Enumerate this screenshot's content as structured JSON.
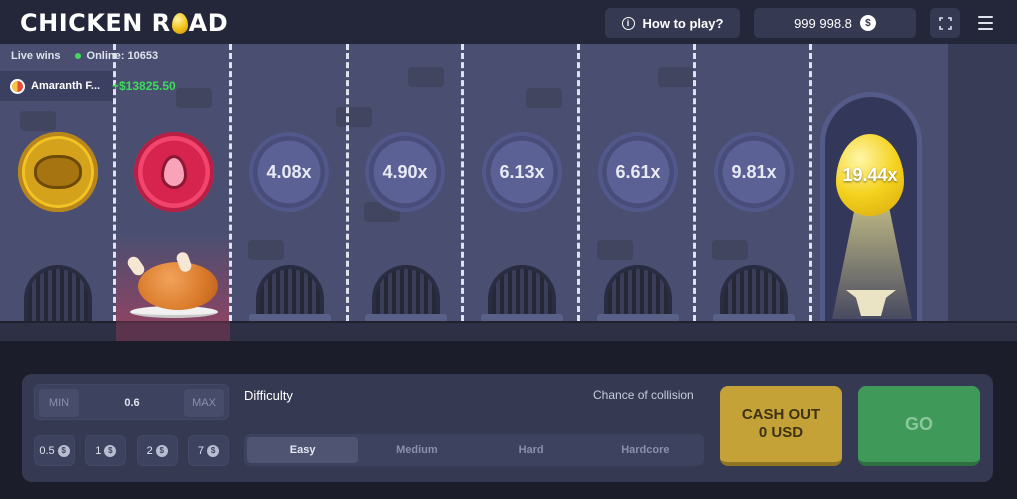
{
  "header": {
    "logo_left": "CHICKEN R",
    "logo_right": "AD",
    "how_to_play": "How to play?",
    "balance": "999 998.8",
    "currency_symbol": "$"
  },
  "live": {
    "label": "Live wins",
    "online": "Online: 10653",
    "winner_name": "Amaranth F...",
    "winner_amount": "+$13825.50"
  },
  "lanes": {
    "multipliers": [
      "4.08x",
      "4.90x",
      "6.13x",
      "6.61x",
      "9.81x"
    ],
    "final_multiplier": "19.44x"
  },
  "controls": {
    "min_label": "MIN",
    "max_label": "MAX",
    "bet_value": "0.6",
    "chips": [
      "0.5",
      "1",
      "2",
      "7"
    ],
    "difficulty_label": "Difficulty",
    "chance_label": "Chance of collision",
    "difficulties": [
      "Easy",
      "Medium",
      "Hard",
      "Hardcore"
    ],
    "cashout_line1": "CASH OUT",
    "cashout_line2": "0 USD",
    "go_label": "GO"
  }
}
